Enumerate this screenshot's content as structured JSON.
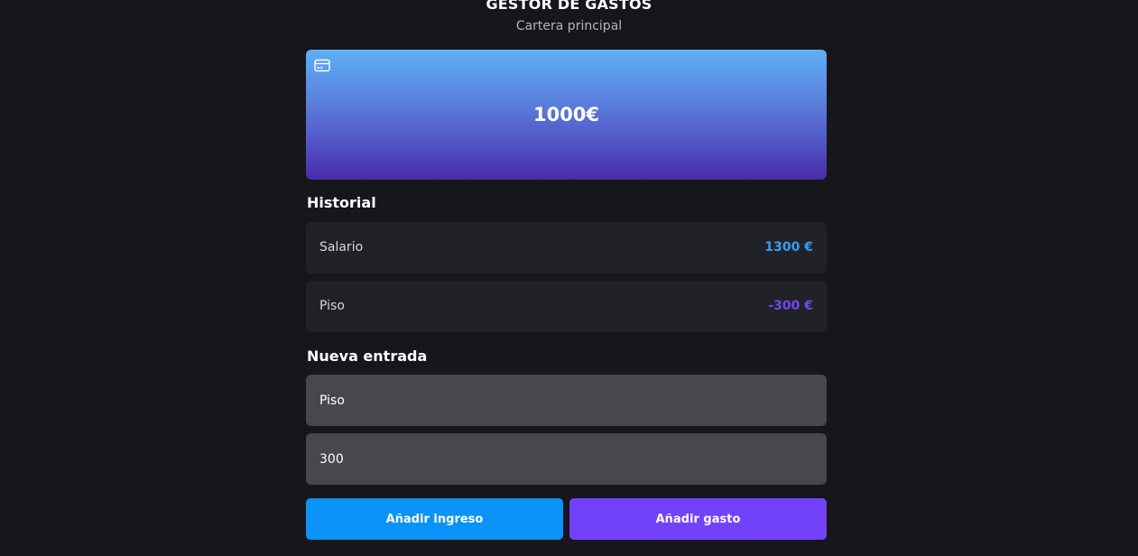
{
  "header": {
    "title": "GESTOR DE GASTOS",
    "subtitle": "Cartera principal"
  },
  "balance_card": {
    "icon": "credit-card-icon",
    "amount": "1000€"
  },
  "history": {
    "title": "Historial",
    "items": [
      {
        "label": "Salario",
        "amount": "1300 €",
        "color": "#3d9af2"
      },
      {
        "label": "Piso",
        "amount": "-300 €",
        "color": "#7046f5"
      }
    ]
  },
  "new_entry": {
    "title": "Nueva entrada",
    "concept_value": "Piso",
    "amount_value": "300",
    "income_button": "Añadir ingreso",
    "expense_button": "Añadir gasto"
  },
  "colors": {
    "background": "#16161b",
    "income": "#0c93f7",
    "expense": "#7242fb"
  }
}
